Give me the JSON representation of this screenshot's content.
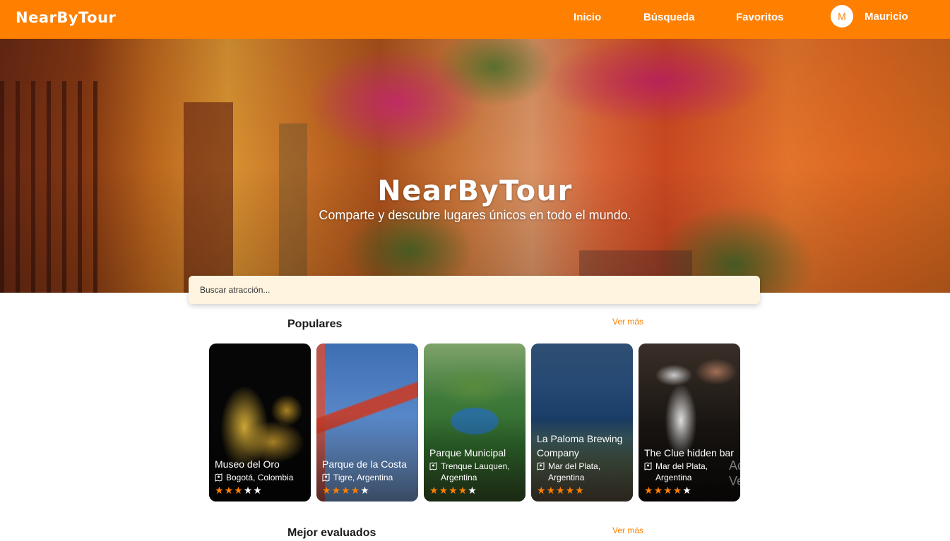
{
  "nav": {
    "logo": "NearByTour",
    "links": [
      "Inicio",
      "Búsqueda",
      "Favoritos"
    ],
    "user": {
      "initial": "M",
      "name": "Mauricio"
    }
  },
  "hero": {
    "title": "NearByTour",
    "subtitle": "Comparte y descubre lugares únicos en todo el mundo."
  },
  "search": {
    "placeholder": "Buscar atracción..."
  },
  "sections": {
    "popular": {
      "title": "Populares",
      "more_label": "Ver más",
      "cards": [
        {
          "name": "Museo del Oro",
          "location": "Bogotá, Colombia",
          "rating": 3
        },
        {
          "name": "Parque de la Costa",
          "location": "Tigre, Argentina",
          "rating": 4
        },
        {
          "name": "Parque Municipal",
          "location": "Trenque Lauquen, Argentina",
          "rating": 4
        },
        {
          "name": "La Paloma Brewing Company",
          "location": "Mar del Plata, Argentina",
          "rating": 5
        },
        {
          "name": "The Clue hidden bar",
          "location": "Mar del Plata, Argentina",
          "rating": 4
        }
      ],
      "overflow_text": "Ac\nVe"
    },
    "best_rated": {
      "title": "Mejor evaluados",
      "more_label": "Ver más"
    }
  },
  "colors": {
    "brand": "#ff7f00",
    "search_bg": "#fff4e0",
    "star_on": "#ff7f00",
    "star_off": "#ffffff"
  },
  "icons": {
    "location": "map-pin-icon",
    "star": "star-icon",
    "avatar": "avatar"
  }
}
